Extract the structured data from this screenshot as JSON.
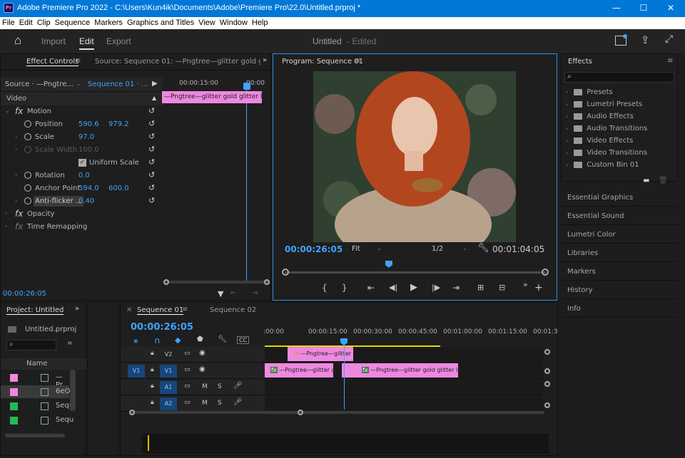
{
  "titlebar": {
    "app_badge": "Pr",
    "title": "Adobe Premiere Pro 2022 - C:\\Users\\Kun4ik\\Documents\\Adobe\\Premiere Pro\\22.0\\Untitled.prproj *",
    "minimize": "—",
    "maximize": "☐",
    "close": "✕"
  },
  "menu": [
    "File",
    "Edit",
    "Clip",
    "Sequence",
    "Markers",
    "Graphics and Titles",
    "View",
    "Window",
    "Help"
  ],
  "workspace": {
    "home": "⌂",
    "import": "Import",
    "edit": "Edit",
    "export": "Export",
    "project_title": "Untitled",
    "status": "- Edited"
  },
  "effect_controls": {
    "tab": "Effect Controls",
    "tab2": "Source: Sequence 01: —Pngtree—glitter gold glitter lig",
    "source": "Source · —Pngtre...",
    "sequence": "Sequence 01 · ...",
    "timecode_ruler": "00:00:15:00",
    "ruler2": "00:00",
    "clip_label": "—Pngtree—glitter gold glitter l",
    "section": "Video",
    "motion": "Motion",
    "position": {
      "label": "Position",
      "x": "590.6",
      "y": "979.2"
    },
    "scale": {
      "label": "Scale",
      "value": "97.0"
    },
    "scale_width": {
      "label": "Scale Width",
      "value": "100.0"
    },
    "uniform": {
      "label": "Uniform Scale",
      "checked": true
    },
    "rotation": {
      "label": "Rotation",
      "value": "0.0"
    },
    "anchor": {
      "label": "Anchor Point",
      "x": "594.0",
      "y": "600.0"
    },
    "antiflicker": {
      "label": "Anti-flicker ...",
      "value": "0.40"
    },
    "opacity": "Opacity",
    "time_remap": "Time Remapping",
    "current_time": "00:00:26:05"
  },
  "program": {
    "tab": "Program: Sequence 01",
    "timecode": "00:00:26:05",
    "fit": "Fit",
    "res": "1/2",
    "duration": "00:01:04:05"
  },
  "effects": {
    "tab": "Effects",
    "items": [
      "Presets",
      "Lumetri Presets",
      "Audio Effects",
      "Audio Transitions",
      "Video Effects",
      "Video Transitions",
      "Custom Bin 01"
    ]
  },
  "side_panels": [
    "Essential Graphics",
    "Essential Sound",
    "Lumetri Color",
    "Libraries",
    "Markers",
    "History",
    "Info"
  ],
  "project": {
    "tab": "Project: Untitled",
    "file": "Untitled.prproj",
    "column": "Name",
    "rows": [
      {
        "name": "—Pr",
        "color": "#ee88e0"
      },
      {
        "name": "6eO",
        "color": "#ee88e0"
      },
      {
        "name": "Sequ",
        "color": "#22bb55"
      },
      {
        "name": "Sequ",
        "color": "#22bb55"
      }
    ]
  },
  "timeline": {
    "tab1": "Sequence 01",
    "tab2": "Sequence 02",
    "timecode": "00:00:26:05",
    "ruler": [
      ":00:00",
      "00:00:15:00",
      "00:00:30:00",
      "00:00:45:00",
      "00:01:00:00",
      "00:01:15:00",
      "00:01:3"
    ],
    "tracks": [
      {
        "src": "",
        "name": "V2"
      },
      {
        "src": "V1",
        "name": "V1"
      },
      {
        "src": "",
        "name": "A1"
      },
      {
        "src": "",
        "name": "A2"
      }
    ],
    "clip_v2": "—Pngtree—glitter",
    "clip_v1a": "—Pngtree—glitter g",
    "clip_v1b": "—Pngtree—glitter gold glitter ligh",
    "m": "M",
    "s": "S"
  },
  "colors": {
    "accent": "#3ea3ff",
    "clip": "#ee88e0",
    "titlebar": "#0078d7"
  }
}
